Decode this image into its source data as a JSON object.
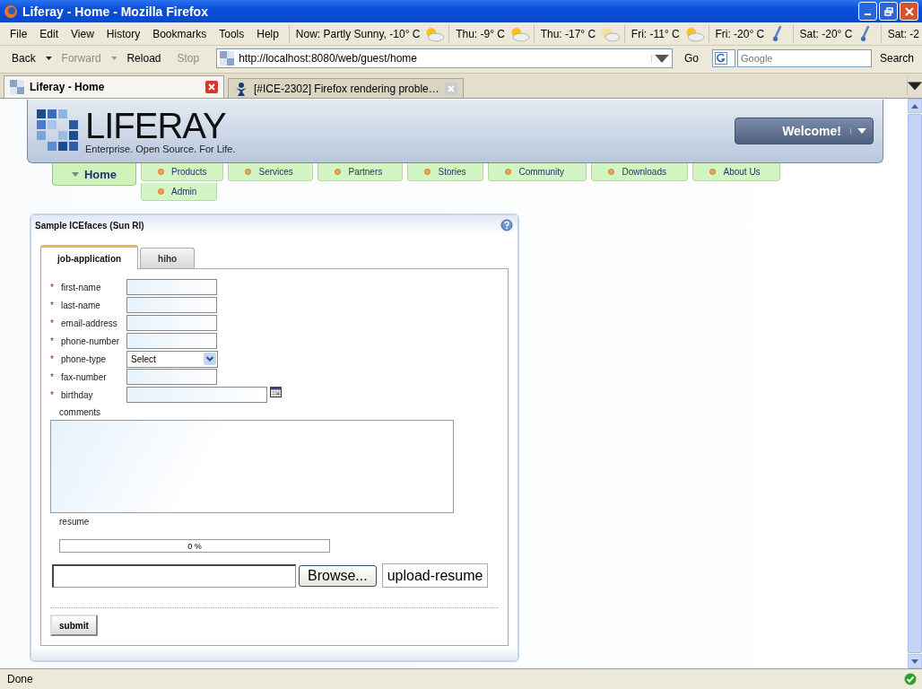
{
  "window": {
    "title": "Liferay - Home - Mozilla Firefox"
  },
  "menu": [
    "File",
    "Edit",
    "View",
    "History",
    "Bookmarks",
    "Tools",
    "Help"
  ],
  "weather": [
    {
      "text": "Now: Partly Sunny, -10° C",
      "kind": "sun"
    },
    {
      "text": "Thu: -9° C",
      "kind": "sun"
    },
    {
      "text": "Thu: -17° C",
      "kind": "moon"
    },
    {
      "text": "Fri: -11° C",
      "kind": "sun"
    },
    {
      "text": "Fri: -20° C",
      "kind": "cold"
    },
    {
      "text": "Sat: -20° C",
      "kind": "cold"
    },
    {
      "text": "Sat: -2",
      "kind": "none"
    }
  ],
  "toolbar": {
    "buttons": [
      {
        "label": "Back",
        "disabled": false,
        "dropdown": true
      },
      {
        "label": "Forward",
        "disabled": true,
        "dropdown": true
      },
      {
        "label": "Reload",
        "disabled": false,
        "dropdown": false
      },
      {
        "label": "Stop",
        "disabled": true,
        "dropdown": false
      }
    ],
    "url": "http://localhost:8080/web/guest/home",
    "go": "Go",
    "search_placeholder": "Google",
    "search_button": "Search"
  },
  "tabs": [
    {
      "label": "Liferay - Home",
      "selected": true
    },
    {
      "label": "[#ICE-2302] Firefox rendering proble…",
      "selected": false
    }
  ],
  "site": {
    "logo": "LIFERAY",
    "tagline": "Enterprise. Open Source. For Life.",
    "welcome": "Welcome!",
    "home": {
      "label": "Home",
      "selected": true
    },
    "nav": [
      "Products",
      "Services",
      "Partners",
      "Stories",
      "Community",
      "Downloads",
      "About Us",
      "Admin"
    ]
  },
  "portlet": {
    "title": "Sample ICEfaces (Sun RI)",
    "tabs": [
      {
        "label": "job-application",
        "selected": true
      },
      {
        "label": "hiho",
        "selected": false
      }
    ],
    "fields": [
      {
        "label": "first-name",
        "marker": "*",
        "kind": "text"
      },
      {
        "label": "last-name",
        "marker": "*",
        "kind": "text"
      },
      {
        "label": "email-address",
        "marker": "*",
        "kind": "text"
      },
      {
        "label": "phone-number",
        "marker": "*",
        "kind": "text"
      },
      {
        "label": "phone-type",
        "marker": "*",
        "kind": "select",
        "value": "Select"
      },
      {
        "label": "fax-number",
        "marker": "*",
        "kind": "text"
      },
      {
        "label": "birthday",
        "marker": "*",
        "kind": "date"
      }
    ],
    "comments_label": "comments",
    "resume_label": "resume",
    "progress": {
      "level": 0,
      "reading": "0 %"
    },
    "browse": "Browse...",
    "upload": "upload-resume",
    "submit": "submit"
  },
  "status_bar": "Done"
}
